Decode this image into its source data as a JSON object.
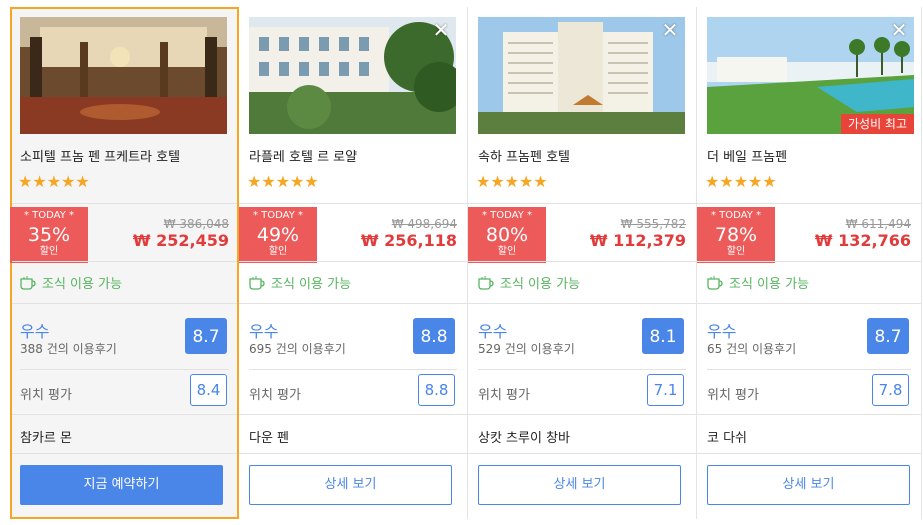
{
  "hotels": [
    {
      "name": "소피텔 프놈 펜 프케트라 호텔",
      "stars": "★★★★★",
      "today": "* TODAY *",
      "discount": "35%",
      "discount_label": "할인",
      "original_price": "₩ 386,048",
      "sale_price": "₩ 252,459",
      "breakfast": "조식 이용 가능",
      "grade": "우수",
      "reviews": "388 건의 이용후기",
      "score": "8.7",
      "location_label": "위치 평가",
      "location_score": "8.4",
      "district": "참카르 몬",
      "button": "지금 예약하기",
      "selected": true,
      "badge": "",
      "close": ""
    },
    {
      "name": "라플레 호텔 르 로얄",
      "stars": "★★★★★",
      "today": "* TODAY *",
      "discount": "49%",
      "discount_label": "할인",
      "original_price": "₩ 498,694",
      "sale_price": "₩ 256,118",
      "breakfast": "조식 이용 가능",
      "grade": "우수",
      "reviews": "695 건의 이용후기",
      "score": "8.8",
      "location_label": "위치 평가",
      "location_score": "8.8",
      "district": "다운 펜",
      "button": "상세 보기",
      "selected": false,
      "badge": "",
      "close": "✕"
    },
    {
      "name": "속하 프놈펜 호텔",
      "stars": "★★★★★",
      "today": "* TODAY *",
      "discount": "80%",
      "discount_label": "할인",
      "original_price": "₩ 555,782",
      "sale_price": "₩ 112,379",
      "breakfast": "조식 이용 가능",
      "grade": "우수",
      "reviews": "529 건의 이용후기",
      "score": "8.1",
      "location_label": "위치 평가",
      "location_score": "7.1",
      "district": "상캇 츠루이 창바",
      "button": "상세 보기",
      "selected": false,
      "badge": "",
      "close": "✕"
    },
    {
      "name": "더 베일 프놈펜",
      "stars": "★★★★★",
      "today": "* TODAY *",
      "discount": "78%",
      "discount_label": "할인",
      "original_price": "₩ 611,494",
      "sale_price": "₩ 132,766",
      "breakfast": "조식 이용 가능",
      "grade": "우수",
      "reviews": "65 건의 이용후기",
      "score": "8.7",
      "location_label": "위치 평가",
      "location_score": "7.8",
      "district": "코 다쉬",
      "button": "상세 보기",
      "selected": false,
      "badge": "가성비 최고",
      "close": "✕"
    }
  ],
  "colors": {
    "accent": "#4a86e8",
    "discount": "#ec5a5a",
    "price": "#e23b3b",
    "star": "#f5a623",
    "breakfast": "#57b560",
    "selected_border": "#f5a623"
  }
}
